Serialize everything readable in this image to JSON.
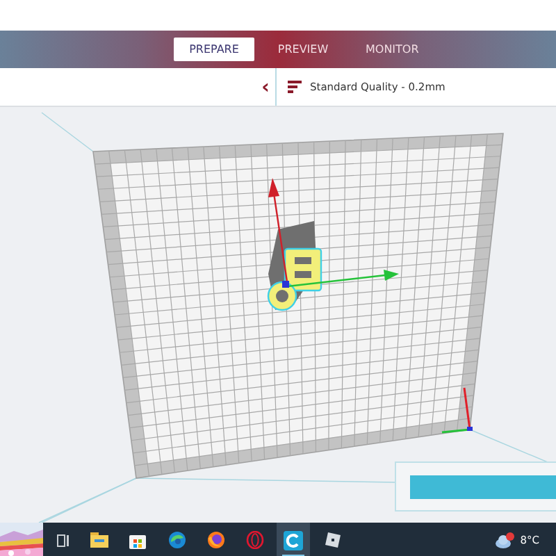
{
  "stage_tabs": [
    {
      "label": "PREPARE",
      "selected": true
    },
    {
      "label": "PREVIEW",
      "selected": false
    },
    {
      "label": "MONITOR",
      "selected": false
    }
  ],
  "toolbar": {
    "collapse_glyph": "‹",
    "print_setup": "Standard Quality - 0.2mm"
  },
  "taskbar": {
    "apps": [
      {
        "kind": "explorer",
        "selected": false
      },
      {
        "kind": "store",
        "selected": false
      },
      {
        "kind": "edge",
        "selected": false
      },
      {
        "kind": "firefox",
        "selected": false
      },
      {
        "kind": "opera",
        "selected": false
      },
      {
        "kind": "cura",
        "selected": true
      },
      {
        "kind": "roblox",
        "selected": false
      }
    ],
    "weather": {
      "temperature": "8°C"
    }
  }
}
